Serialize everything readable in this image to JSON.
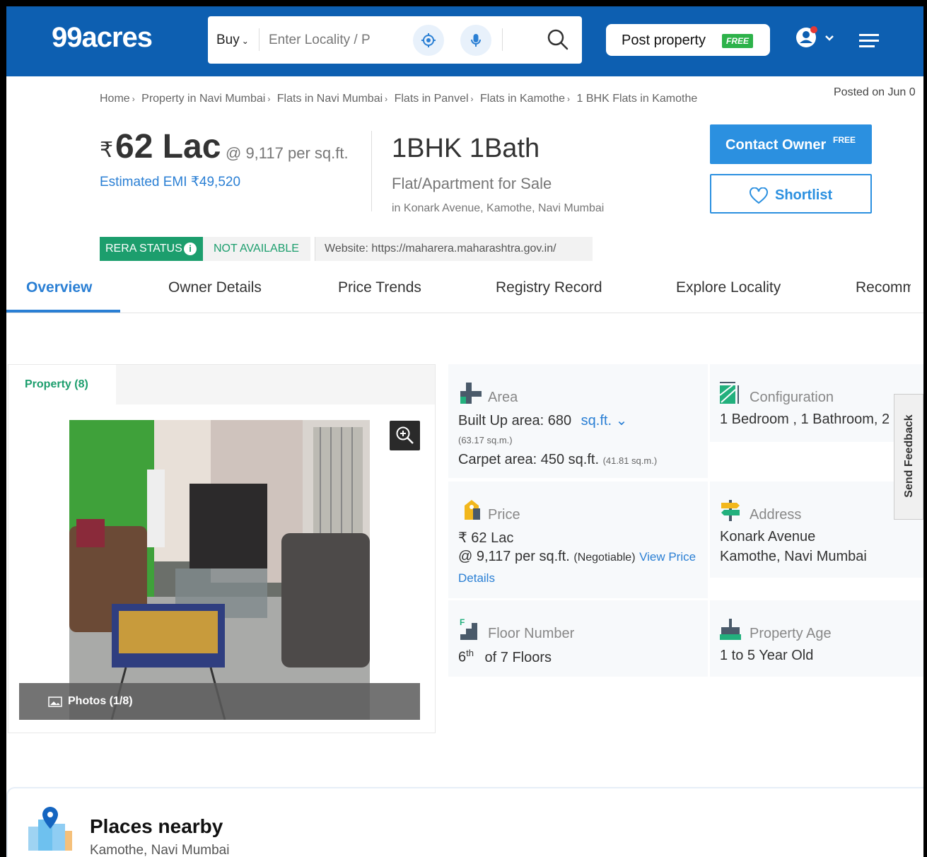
{
  "header": {
    "logo": "99acres",
    "buy_label": "Buy",
    "search_placeholder": "Enter Locality / P",
    "post_property_label": "Post property",
    "free_badge": "FREE"
  },
  "breadcrumbs": [
    "Home",
    "Property in Navi Mumbai",
    "Flats in Navi Mumbai",
    "Flats in Panvel",
    "Flats in Kamothe",
    "1 BHK Flats in Kamothe"
  ],
  "posted_on": "Posted on Jun 0",
  "listing": {
    "rupee_symbol": "₹",
    "price": "62 Lac",
    "price_per_sqft": "@ 9,117 per sq.ft.",
    "emi": "Estimated EMI ₹49,520",
    "bhk": "1BHK 1Bath",
    "type": "Flat/Apartment for Sale",
    "location": "in Konark Avenue, Kamothe, Navi Mumbai",
    "contact_label": "Contact Owner",
    "contact_free": "FREE",
    "shortlist_label": "Shortlist"
  },
  "rera": {
    "badge": "RERA STATUS",
    "info": "i",
    "status": "NOT AVAILABLE",
    "website": "Website: https://maharera.maharashtra.gov.in/"
  },
  "tabs": [
    "Overview",
    "Owner Details",
    "Price Trends",
    "Registry Record",
    "Explore Locality",
    "Recomm"
  ],
  "gallery": {
    "tab": "Property (8)",
    "photos_label": "Photos (1/8)"
  },
  "details": {
    "area": {
      "label": "Area",
      "built_up": "Built Up area: 680",
      "unit": "sq.ft.",
      "built_up_sqm": "(63.17 sq.m.)",
      "carpet": "Carpet area: 450 sq.ft.",
      "carpet_sqm": "(41.81 sq.m.)"
    },
    "configuration": {
      "label": "Configuration",
      "value": "1 Bedroom , 1 Bathroom, 2"
    },
    "price": {
      "label": "Price",
      "value": "₹ 62 Lac",
      "per_sqft": "@ 9,117 per sq.ft.",
      "negotiable": "(Negotiable)",
      "view_price": "View Price",
      "details_link": "Details"
    },
    "address": {
      "label": "Address",
      "line1": "Konark Avenue",
      "line2": "Kamothe, Navi Mumbai"
    },
    "floor": {
      "label": "Floor Number",
      "floor": "6",
      "suffix": "th",
      "of_floors": "of 7 Floors"
    },
    "age": {
      "label": "Property Age",
      "value": "1 to 5 Year Old"
    }
  },
  "feedback_label": "Send Feedback",
  "nearby": {
    "title": "Places nearby",
    "subtitle": "Kamothe, Navi Mumbai"
  }
}
